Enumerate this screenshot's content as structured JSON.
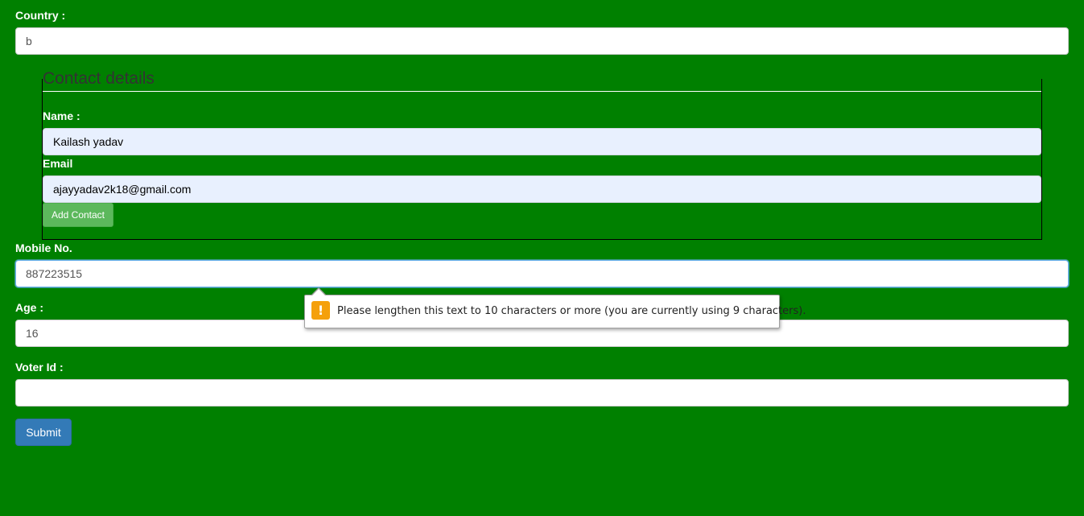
{
  "form": {
    "country": {
      "label": "Country :",
      "value": "b"
    },
    "contact": {
      "legend": "Contact details",
      "name": {
        "label": "Name :",
        "value": "Kailash yadav"
      },
      "email": {
        "label": "Email",
        "value": "ajayyadav2k18@gmail.com"
      },
      "add_button": "Add Contact"
    },
    "mobile": {
      "label": "Mobile No.",
      "value": "887223515"
    },
    "age": {
      "label": "Age :",
      "value": "16"
    },
    "voter_id": {
      "label": "Voter Id :",
      "value": ""
    },
    "submit_button": "Submit"
  },
  "validation_tooltip": {
    "icon": "warning-icon",
    "icon_glyph": "!",
    "message": "Please lengthen this text to 10 characters or more (you are currently using 9 characters)."
  },
  "colors": {
    "background": "#008000",
    "submit": "#337ab7",
    "add_contact": "#5cb85c",
    "warning": "#f5a00b"
  }
}
